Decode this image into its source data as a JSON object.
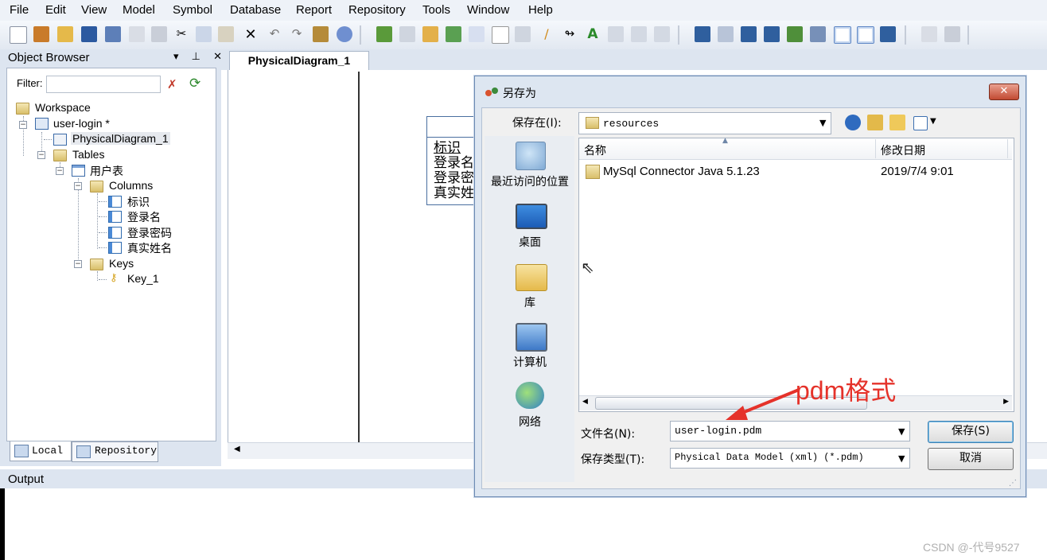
{
  "menu": [
    "File",
    "Edit",
    "View",
    "Model",
    "Symbol",
    "Database",
    "Report",
    "Repository",
    "Tools",
    "Window",
    "Help"
  ],
  "object_browser": {
    "title": "Object Browser",
    "controls": "▾ ⊥ ✕",
    "filter_label": "Filter:",
    "filter_value": "",
    "tree": {
      "workspace": "Workspace",
      "model": "user-login *",
      "diagram": "PhysicalDiagram_1",
      "tables": "Tables",
      "table": "用户表",
      "columns": "Columns",
      "column_items": [
        "标识",
        "登录名",
        "登录密码",
        "真实姓名"
      ],
      "keys": "Keys",
      "key_item": "Key_1"
    },
    "tabs": [
      "Local",
      "Repository"
    ]
  },
  "diagram": {
    "tab": "PhysicalDiagram_1",
    "entity_columns": [
      "标识",
      "登录名",
      "登录密",
      "真实姓"
    ]
  },
  "output": {
    "title": "Output"
  },
  "dialog": {
    "title": "另存为",
    "close": "✕",
    "save_in_label": "保存在(I):",
    "save_in_value": "resources",
    "places": [
      "最近访问的位置",
      "桌面",
      "库",
      "计算机",
      "网络"
    ],
    "columns": {
      "name": "名称",
      "date": "修改日期"
    },
    "files": [
      {
        "name": "MySql Connector Java 5.1.23",
        "date": "2019/7/4 9:01"
      }
    ],
    "filename_label": "文件名(N):",
    "filename_value": "user-login.pdm",
    "filetype_label": "保存类型(T):",
    "filetype_value": "Physical Data Model (xml) (*.pdm)",
    "save_button": "保存(S)",
    "cancel_button": "取消"
  },
  "annotation": {
    "text": "pdm格式",
    "color": "#e5322a"
  },
  "watermark": "CSDN @-代号9527",
  "colors": {
    "chrome": "#dde5f0",
    "dialog_frame": "#dde6f1",
    "close_red": "#c24a32"
  }
}
